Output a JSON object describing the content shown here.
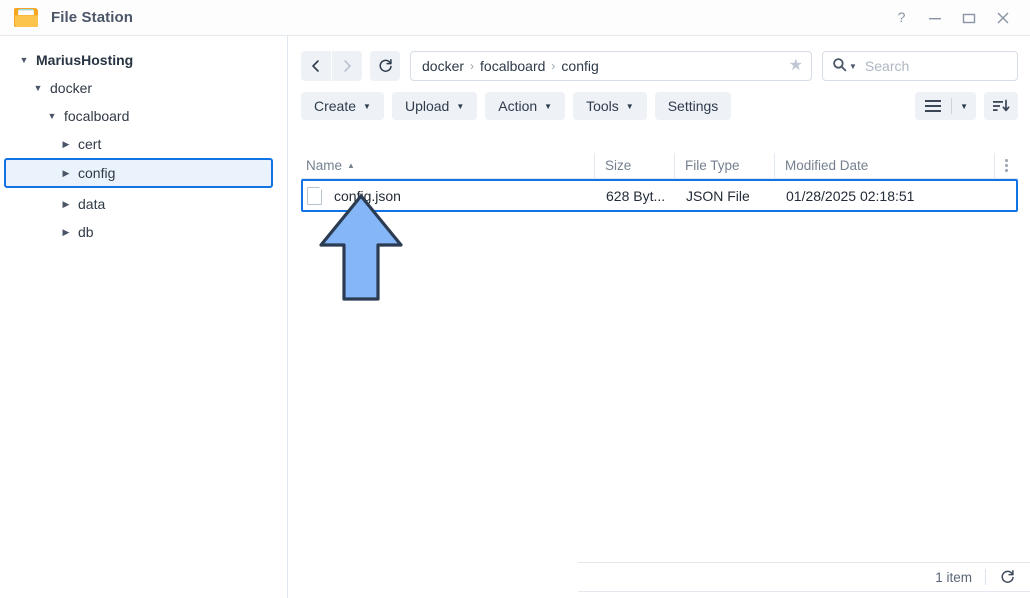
{
  "window": {
    "title": "File Station",
    "icon": "folder-icon",
    "controls": [
      {
        "name": "help",
        "glyph": "?"
      },
      {
        "name": "minimize",
        "glyph": "–"
      },
      {
        "name": "maximize",
        "glyph": "☐"
      },
      {
        "name": "close",
        "glyph": "✕"
      }
    ]
  },
  "sidebar": {
    "items": [
      {
        "label": "MariusHosting",
        "depth": 0,
        "expanded": true,
        "selected": false,
        "root": true
      },
      {
        "label": "docker",
        "depth": 1,
        "expanded": true,
        "selected": false,
        "root": false
      },
      {
        "label": "focalboard",
        "depth": 2,
        "expanded": true,
        "selected": false,
        "root": false
      },
      {
        "label": "cert",
        "depth": 3,
        "expanded": false,
        "selected": false,
        "root": false
      },
      {
        "label": "config",
        "depth": 3,
        "expanded": false,
        "selected": true,
        "root": false
      },
      {
        "label": "data",
        "depth": 3,
        "expanded": false,
        "selected": false,
        "root": false
      },
      {
        "label": "db",
        "depth": 3,
        "expanded": false,
        "selected": false,
        "root": false
      }
    ]
  },
  "navbar": {
    "back_enabled": true,
    "forward_enabled": false,
    "refresh_label": "refresh",
    "breadcrumb": [
      "docker",
      "focalboard",
      "config"
    ],
    "breadcrumb_separator": "›",
    "favorite_icon": "star-icon"
  },
  "search": {
    "query_glyph": "Q",
    "placeholder": "Search",
    "value": ""
  },
  "toolbar": {
    "buttons": [
      {
        "label": "Create",
        "dropdown": true
      },
      {
        "label": "Upload",
        "dropdown": true
      },
      {
        "label": "Action",
        "dropdown": true
      },
      {
        "label": "Tools",
        "dropdown": true
      },
      {
        "label": "Settings",
        "dropdown": false
      }
    ],
    "view_button": "list-view",
    "sort_button": "sort-order"
  },
  "filelist": {
    "columns": [
      {
        "key": "name",
        "label": "Name",
        "sorted": "asc"
      },
      {
        "key": "size",
        "label": "Size",
        "sorted": ""
      },
      {
        "key": "type",
        "label": "File Type",
        "sorted": ""
      },
      {
        "key": "date",
        "label": "Modified Date",
        "sorted": ""
      }
    ],
    "sort_caret": "▲",
    "rows": [
      {
        "name": "config.json",
        "size": "628 Byt...",
        "type": "JSON File",
        "date": "01/28/2025 02:18:51",
        "selected": true,
        "icon": "file-icon"
      }
    ]
  },
  "annotation": {
    "arrow": {
      "direction": "up",
      "fill": "#85b6f7",
      "stroke": "#2b3b52"
    }
  },
  "statusbar": {
    "item_count": "1 item",
    "refresh_label": "refresh"
  },
  "colors": {
    "accent": "#1273e6",
    "selection_bg": "#eaf2fc",
    "button_bg": "#eef1f6",
    "border": "#dfe6ee",
    "text": "#303a46",
    "muted_text": "#76818f",
    "folder": "#f5a623"
  }
}
